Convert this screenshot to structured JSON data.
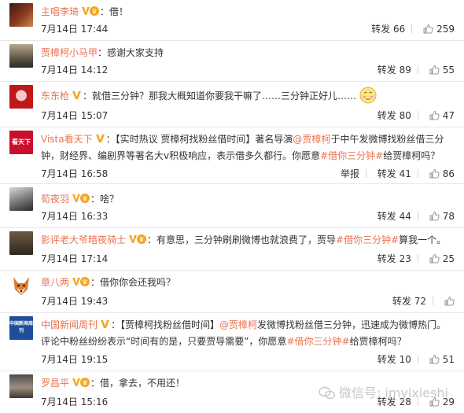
{
  "comments": [
    {
      "user": "主唱李琦",
      "line": "：借！",
      "time": "7月14日 17:44",
      "repost": "转发 66",
      "likes": "259",
      "vip": true
    },
    {
      "user": "贾樟柯小马甲",
      "line": "：感谢大家支持",
      "time": "7月14日 14:12",
      "repost": "转发 89",
      "likes": "55",
      "vip": false
    },
    {
      "user": "东东枪",
      "line": "：就借三分钟？那我大概知道你要我干嘛了……三分钟正好儿……",
      "time": "7月14日 15:07",
      "repost": "转发 80",
      "likes": "47",
      "vip": true
    },
    {
      "user": "Vista看天下",
      "line_a": "：【实时热议 贾樟柯找粉丝借时间】著名导演",
      "mention": "@贾樟柯",
      "line_b": "于中午发微博找粉丝借三分",
      "line2_a": "钟，财经界、编剧界等著名大v积极响应，表示借多久都行。你愿意",
      "topic": "#借你三分钟#",
      "line2_b": "给贾樟柯吗？",
      "time": "7月14日 16:58",
      "report": "举报",
      "repost": "转发 41",
      "likes": "86",
      "vip": true
    },
    {
      "user": "荀夜羽",
      "line": "：啥？",
      "time": "7月14日 16:33",
      "repost": "转发 44",
      "likes": "78",
      "vip": true
    },
    {
      "user": "影评老大爷暗夜骑士",
      "line_a": "：有意思，三分钟刷刷微博也就浪费了，贾导",
      "topic": "#借你三分钟#",
      "line_b": "算我一个。",
      "time": "7月14日 17:14",
      "repost": "转发 23",
      "likes": "25",
      "vip": true
    },
    {
      "user": "章八两",
      "line": "：借你你会还我吗？",
      "time": "7月14日 19:43",
      "repost": "转发 72",
      "likes": "",
      "vip": true
    },
    {
      "user": "中国新闻周刊",
      "line_a": "：【贾樟柯找粉丝借时间】",
      "mention": "@贾樟柯",
      "line_b": "发微博找粉丝借三分钟，迅速成为微博热门。",
      "line2_a": "评论中粉丝纷纷表示“时间有的是，只要贾导需要”，你愿意",
      "topic": "#借你三分钟#",
      "line2_b": "给贾樟柯吗？",
      "time": "7月14日 19:15",
      "repost": "转发 10",
      "likes": "51",
      "vip": true
    },
    {
      "user": "罗昌平",
      "line": "：借，拿去，不用还！",
      "time": "7月14日 15:16",
      "repost": "转发 28",
      "likes": "29",
      "vip": true
    }
  ],
  "avatars": {
    "a3": "看天下",
    "a7": "中国新闻周刊"
  },
  "watermark": "微信号: imyixieshi",
  "colors": {
    "username": "#eb7350",
    "vip": "#f5a623"
  }
}
